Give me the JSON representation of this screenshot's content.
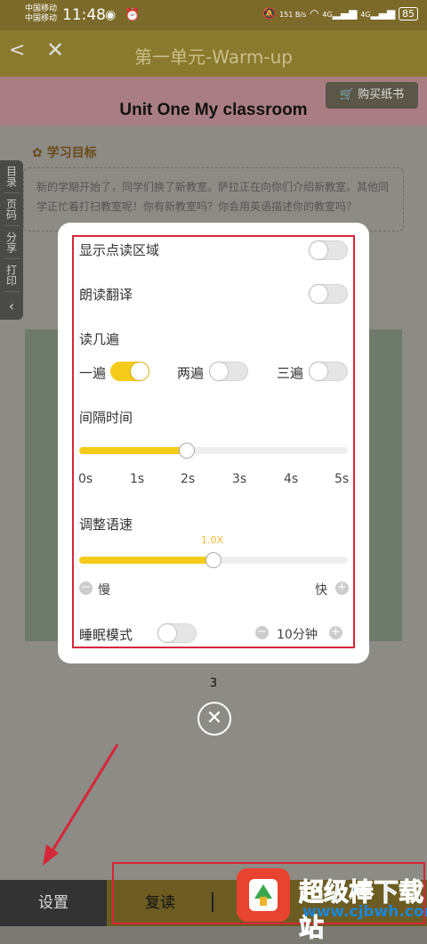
{
  "status_bar": {
    "carrier_1": "中国移动",
    "carrier_2": "中国移动",
    "time": "11:48",
    "net_speed": "151 B/s",
    "signal_1": "4G",
    "signal_2": "4G",
    "battery": "85"
  },
  "header": {
    "title": "第一单元-Warm-up"
  },
  "page": {
    "buy_button": "购买纸书",
    "unit_title": "Unit One  My classroom",
    "goal_label": "学习目标",
    "goal_text": "新的学期开始了，同学们换了新教室。萨拉正在向你们介绍新教室。其他同学正忙着打扫教室呢！你有新教室吗？你会用英语描述你的教室吗？"
  },
  "sidebar": {
    "items": [
      "目录",
      "页码",
      "分享",
      "打印"
    ]
  },
  "settings": {
    "show_area_label": "显示点读区域",
    "show_area_on": false,
    "translate_label": "朗读翻译",
    "translate_on": false,
    "repeat_label": "读几遍",
    "repeat_options": [
      {
        "label": "一遍",
        "on": true
      },
      {
        "label": "两遍",
        "on": false
      },
      {
        "label": "三遍",
        "on": false
      }
    ],
    "interval_label": "间隔时间",
    "interval_ticks": [
      "0s",
      "1s",
      "2s",
      "3s",
      "4s",
      "5s"
    ],
    "interval_value": 0.4,
    "speed_label": "调整语速",
    "speed_value_text": "1.0X",
    "speed_value": 0.5,
    "slow_label": "慢",
    "fast_label": "快",
    "sleep_label": "睡眠模式",
    "sleep_on": false,
    "sleep_time": "10分钟"
  },
  "page_number": "3",
  "bottom_bar": {
    "settings": "设置",
    "repeat": "复读"
  },
  "watermark": {
    "text": "超级棒下载站",
    "url": "www.cjbwh.com"
  },
  "colors": {
    "accent": "#f5cb1b",
    "annotation": "#d6263a"
  }
}
